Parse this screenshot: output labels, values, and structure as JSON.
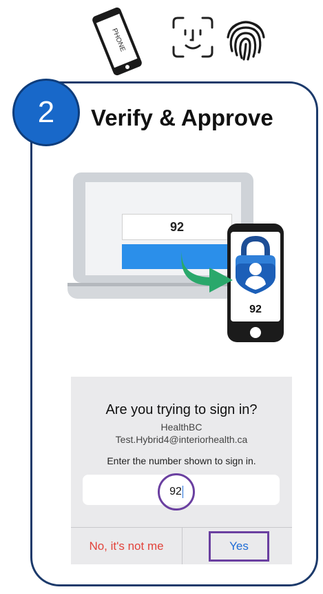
{
  "icons": {
    "phone_label": "PHONE"
  },
  "step": {
    "number": "2",
    "title": "Verify & Approve"
  },
  "illustration": {
    "laptop_number": "92",
    "phone_number": "92"
  },
  "dialog": {
    "title": "Are you trying to sign in?",
    "org": "HealthBC",
    "email": "Test.Hybrid4@interiorhealth.ca",
    "instruction": "Enter the number shown to sign in.",
    "entered_number": "92",
    "deny_label": "No, it's not me",
    "approve_label": "Yes"
  },
  "colors": {
    "badge": "#1868c9",
    "card_border": "#1c3a6b",
    "highlight": "#6a3fa0",
    "deny": "#e2433b",
    "approve": "#1e6cd6",
    "arrow": "#2aa86b"
  }
}
